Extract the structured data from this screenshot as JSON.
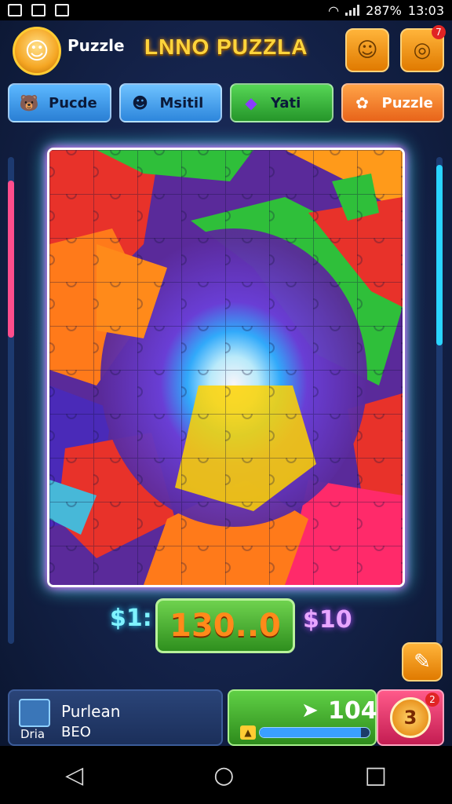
{
  "status_bar": {
    "battery_text": "287%",
    "time": "13:03"
  },
  "header": {
    "player_name": "Puzzle",
    "game_title": "LNNO PUZZLA",
    "avatar_icon": "cartoon-kid-icon",
    "buttons": [
      {
        "icon": "owl-icon",
        "glyph": "☺"
      },
      {
        "icon": "coin-icon",
        "glyph": "◎",
        "badge": "7"
      }
    ]
  },
  "tabs": [
    {
      "label": "Pucde",
      "icon": "bear-icon",
      "glyph": "🐻"
    },
    {
      "label": "Msitil",
      "icon": "girl-icon",
      "glyph": "☻"
    },
    {
      "label": "Yati",
      "icon": "gem-icon",
      "glyph": "◆"
    },
    {
      "label": "Puzzle",
      "icon": "fox-icon",
      "glyph": "✿"
    }
  ],
  "score": {
    "left_label": "$1:",
    "main_value": "130..0",
    "right_label": "$10"
  },
  "bottom": {
    "panel_title": "Purlean",
    "panel_sub": "Dria",
    "panel_value": "BEO",
    "count": "104",
    "progress": 0.92,
    "coin_symbol": "3",
    "coin_badge": "2"
  },
  "nav": {
    "back": "◁",
    "home": "○",
    "recent": "□"
  },
  "colors": {
    "accent_orange": "#ffb43a",
    "green": "#56d655",
    "board_glow_pink": "#ff4dff",
    "board_glow_cyan": "#44ffff"
  }
}
